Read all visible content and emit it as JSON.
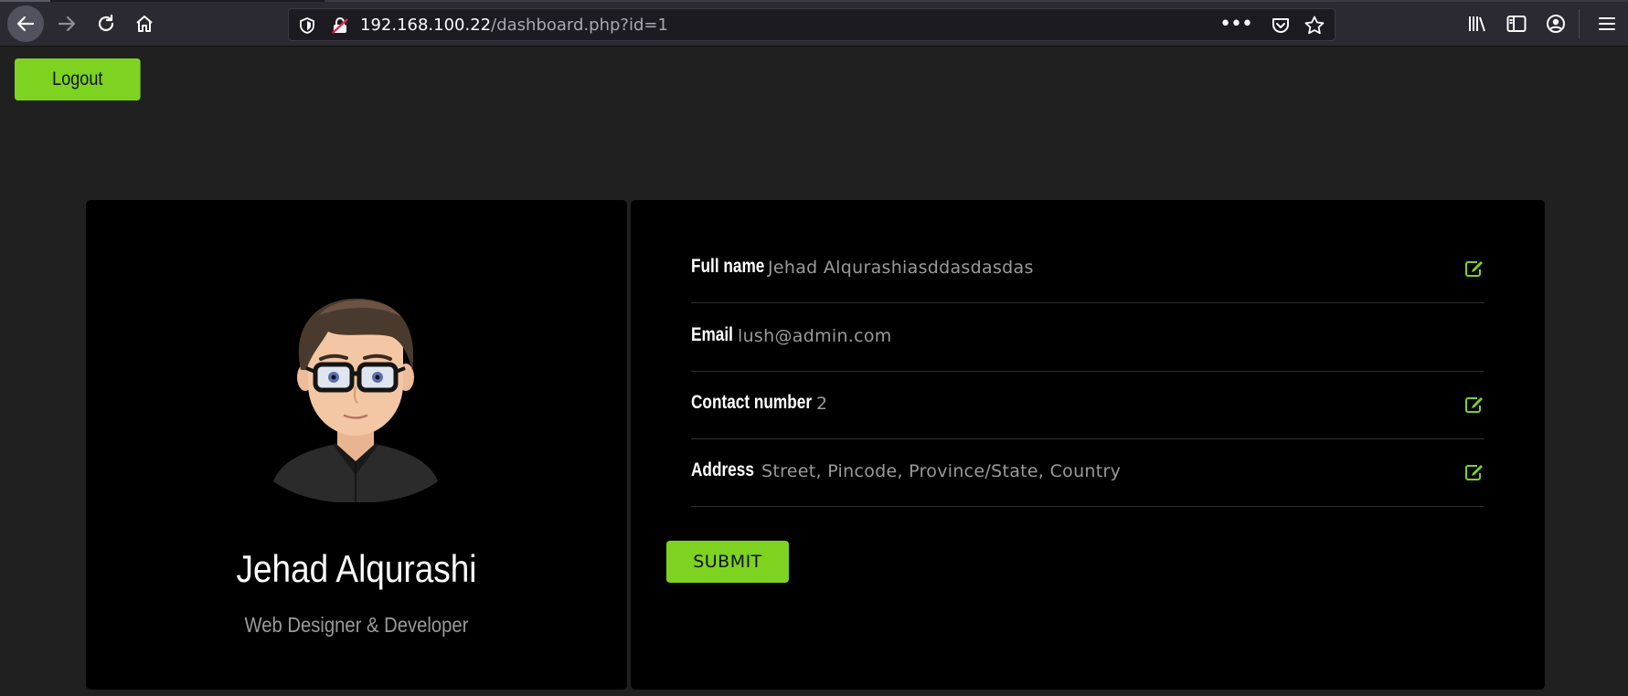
{
  "browser": {
    "url_host": "192.168.100.22",
    "url_path": "/dashboard.php?id=1",
    "icons": [
      "back-arrow-icon",
      "forward-arrow-icon",
      "reload-icon",
      "home-icon",
      "shield-icon",
      "insecure-lock-icon",
      "more-dots-icon",
      "pocket-icon",
      "star-icon",
      "library-icon",
      "sidebar-icon",
      "account-icon",
      "hamburger-menu-icon"
    ]
  },
  "page": {
    "logout_label": "Logout",
    "accent_color": "#7ed321",
    "profile": {
      "name": "Jehad Alqurashi",
      "role": "Web Designer & Developer"
    },
    "fields": {
      "full_name": {
        "label": "Full name",
        "value": "Jehad Alqurashiasddasdasdas"
      },
      "email": {
        "label": "Email",
        "value": "lush@admin.com"
      },
      "contact": {
        "label": "Contact number",
        "value": "2"
      },
      "address": {
        "label": "Address",
        "value": "Street, Pincode, Province/State, Country"
      }
    },
    "submit_label": "SUBMIT"
  }
}
